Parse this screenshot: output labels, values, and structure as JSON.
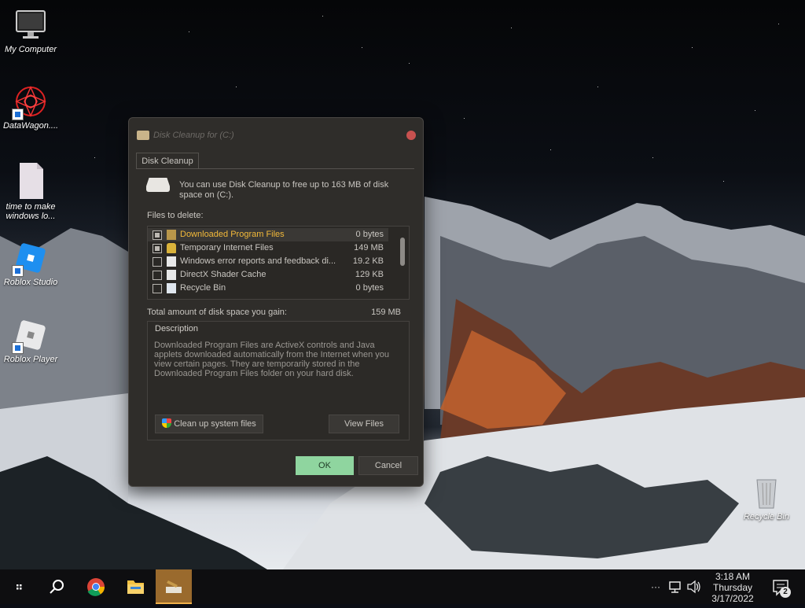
{
  "desktop": {
    "icons": [
      {
        "label": "My Computer"
      },
      {
        "label": "DataWagon...."
      },
      {
        "label": "time to make windows lo..."
      },
      {
        "label": "Roblox Studio"
      },
      {
        "label": "Roblox Player"
      },
      {
        "label": "Recycle Bin"
      }
    ]
  },
  "dialog": {
    "title": "Disk Cleanup for  (C:)",
    "tab_label": "Disk Cleanup",
    "intro_text": "You can use Disk Cleanup to free up to 163 MB of disk space on  (C:).",
    "files_to_delete_label": "Files to delete:",
    "files": [
      {
        "name": "Downloaded Program Files",
        "size": "0 bytes",
        "checked": true,
        "selected": true
      },
      {
        "name": "Temporary Internet Files",
        "size": "149 MB",
        "checked": true,
        "selected": false
      },
      {
        "name": "Windows error reports and feedback di...",
        "size": "19.2 KB",
        "checked": false,
        "selected": false
      },
      {
        "name": "DirectX Shader Cache",
        "size": "129 KB",
        "checked": false,
        "selected": false
      },
      {
        "name": "Recycle Bin",
        "size": "0 bytes",
        "checked": false,
        "selected": false
      }
    ],
    "total_label": "Total amount of disk space you gain:",
    "total_value": "159 MB",
    "description_title": "Description",
    "description_text": "Downloaded Program Files are ActiveX controls and Java applets downloaded automatically from the Internet when you view certain pages. They are temporarily stored in the Downloaded Program Files folder on your hard disk.",
    "cleanup_system_label": "Clean up system files",
    "view_files_label": "View Files",
    "ok_label": "OK",
    "cancel_label": "Cancel"
  },
  "taskbar": {
    "time": "3:18 AM",
    "day": "Thursday",
    "date": "3/17/2022",
    "notification_count": "2",
    "overflow_label": "···"
  },
  "colors": {
    "accent_ok": "#8fd59f",
    "selected_text": "#f2b93a",
    "active_task": "#9a6a2d"
  }
}
